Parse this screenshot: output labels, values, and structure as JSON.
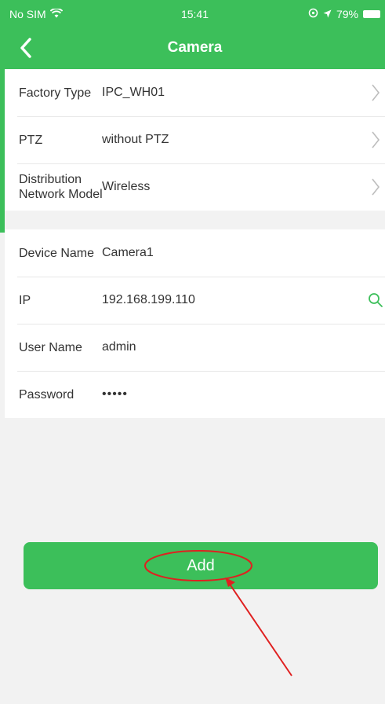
{
  "status_bar": {
    "carrier": "No SIM",
    "time": "15:41",
    "battery": "79%"
  },
  "navbar": {
    "title": "Camera"
  },
  "device_info": [
    {
      "label": "Factory Type",
      "value": "IPC_WH01"
    },
    {
      "label": "PTZ",
      "value": "without PTZ"
    },
    {
      "label": "Distribution Network Model",
      "value": "Wireless"
    }
  ],
  "credentials": {
    "device_name": {
      "label": "Device Name",
      "value": "Camera1"
    },
    "ip": {
      "label": "IP",
      "value": "192.168.199.110"
    },
    "user_name": {
      "label": "User Name",
      "value": "admin"
    },
    "password": {
      "label": "Password",
      "value": "•••••"
    }
  },
  "add_button": {
    "label": "Add"
  },
  "colors": {
    "accent": "#3cbf5a",
    "annotation": "#e02020"
  }
}
